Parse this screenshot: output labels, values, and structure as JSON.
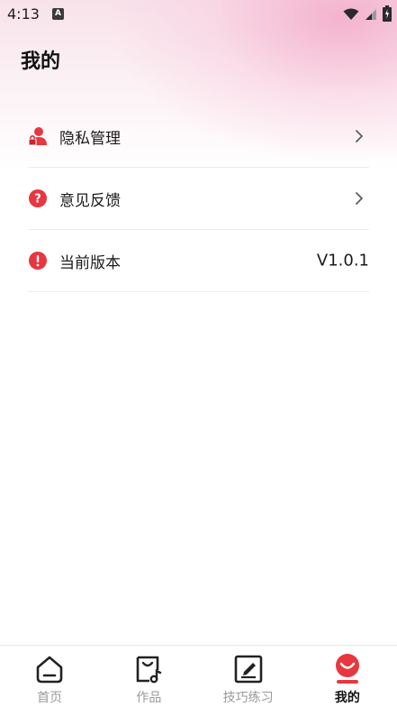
{
  "status_bar": {
    "time": "4:13",
    "notification_icon": "A"
  },
  "page": {
    "title": "我的"
  },
  "menu": {
    "items": [
      {
        "label": "隐私管理",
        "icon": "privacy-user-lock-icon",
        "right": "chevron"
      },
      {
        "label": "意见反馈",
        "icon": "question-icon",
        "right": "chevron"
      },
      {
        "label": "当前版本",
        "icon": "info-icon",
        "value": "V1.0.1"
      }
    ]
  },
  "bottom_nav": {
    "items": [
      {
        "label": "首页",
        "icon": "home-icon",
        "active": false
      },
      {
        "label": "作品",
        "icon": "works-bag-icon",
        "active": false
      },
      {
        "label": "技巧练习",
        "icon": "practice-edit-icon",
        "active": false
      },
      {
        "label": "我的",
        "icon": "profile-smile-icon",
        "active": true
      }
    ]
  },
  "colors": {
    "accent": "#e8373f",
    "text": "#1a1a1a",
    "inactive": "#9a9a9a",
    "gradient_pink": "#f2aac8"
  }
}
